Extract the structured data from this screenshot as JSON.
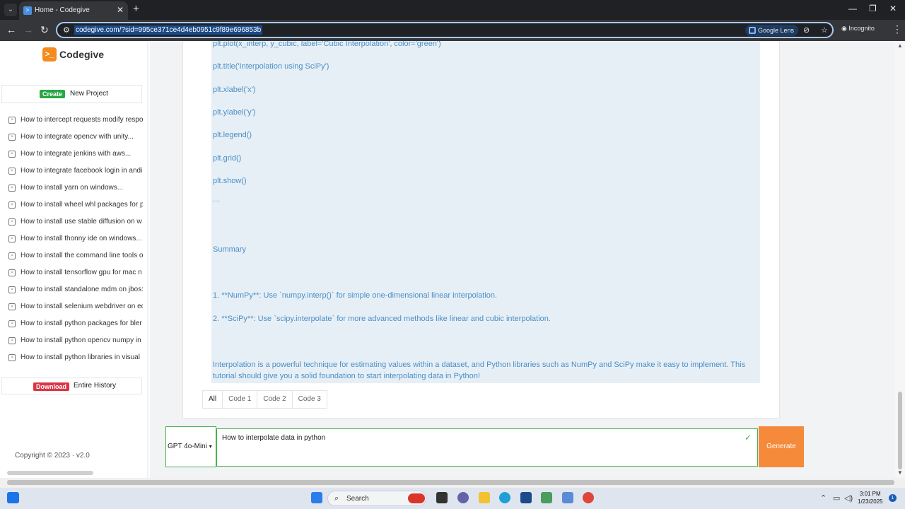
{
  "browser": {
    "tab_title": "Home - Codegive",
    "url": "codegive.com/?sid=995ce371ce4d4eb0951c9f89e696853b",
    "lens_label": "Google Lens",
    "incognito_label": "Incognito"
  },
  "sidebar": {
    "brand": "Codegive",
    "new_project_badge": "Create",
    "new_project_label": "New Project",
    "history": [
      "How to intercept requests modify respo",
      "How to integrate opencv with unity...",
      "How to integrate jenkins with aws...",
      "How to integrate facebook login in andi",
      "How to install yarn on windows...",
      "How to install wheel whl packages for p",
      "How to install use stable diffusion on w",
      "How to install thonny ide on windows...",
      "How to install the command line tools o",
      "How to install tensorflow gpu for mac n",
      "How to install standalone mdm on jbos:",
      "How to install selenium webdriver on ec",
      "How to install python packages for bler",
      "How to install python opencv numpy in",
      "How to install python libraries in visual"
    ],
    "download_badge": "Download",
    "download_label": "Entire History",
    "copyright": "Copyright © 2023   ·   v2.0"
  },
  "content": {
    "lines": [
      "plt.plot(x_interp, y_cubic, label='Cubic Interpolation', color='green')",
      "plt.title('Interpolation using SciPy')",
      "plt.xlabel('x')",
      "plt.ylabel('y')",
      "plt.legend()",
      "plt.grid()",
      "plt.show()",
      "...",
      "Summary",
      "1. **NumPy**: Use `numpy.interp()` for simple one-dimensional linear interpolation.",
      "2. **SciPy**: Use `scipy.interpolate` for more advanced methods like linear and cubic interpolation.",
      "Interpolation is a powerful technique for estimating values within a dataset, and Python libraries such as NumPy and SciPy make it easy to implement. This tutorial should give you a solid foundation to start interpolating data in Python!"
    ],
    "tabs": [
      "All",
      "Code 1",
      "Code 2",
      "Code 3"
    ]
  },
  "composer": {
    "model": "GPT 4o-Mini",
    "prompt": "How to interpolate data in python",
    "generate_label": "Generate"
  },
  "taskbar": {
    "search_label": "Search",
    "time": "3:01 PM",
    "date": "1/23/2025",
    "notifications": "1"
  }
}
